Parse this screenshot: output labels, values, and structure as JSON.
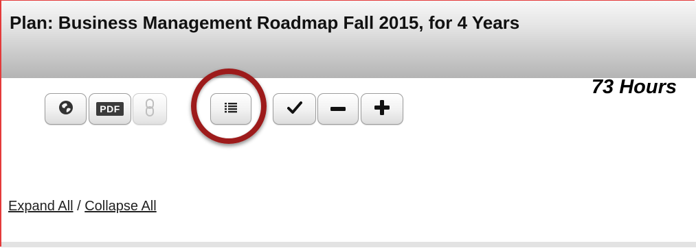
{
  "plan": {
    "title": "Plan: Business Management Roadmap Fall 2015, for 4 Years",
    "hours": "73 Hours"
  },
  "toolbar": {
    "pdf_label": "PDF",
    "buttons": [
      {
        "icon": "globe-icon"
      },
      {
        "icon": "pdf-icon"
      },
      {
        "icon": "link-icon",
        "disabled": true
      },
      {
        "icon": "list-icon",
        "highlighted": true
      },
      {
        "icon": "check-icon"
      },
      {
        "icon": "minus-icon"
      },
      {
        "icon": "plus-icon"
      }
    ]
  },
  "links": {
    "expand_all": "Expand All",
    "separator": " / ",
    "collapse_all": "Collapse All"
  },
  "colors": {
    "highlight_ring": "#9d1b1b",
    "panel_border": "#e43a3a"
  }
}
